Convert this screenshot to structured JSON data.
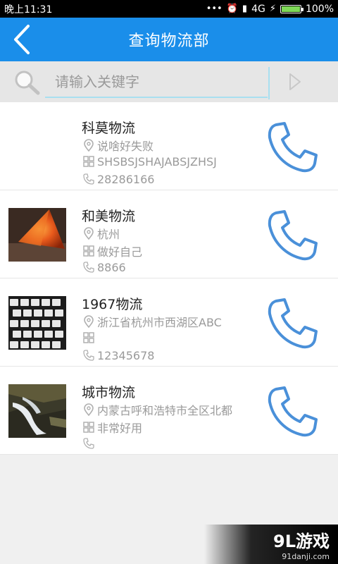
{
  "status_bar": {
    "time": "晚上11:31",
    "network": "4G",
    "battery": "100%"
  },
  "app_bar": {
    "title": "查询物流部"
  },
  "search": {
    "placeholder": "请输入关键字",
    "value": ""
  },
  "companies": [
    {
      "name": "科莫物流",
      "address": "说啥好失败",
      "note": "SHSBSJSHAJABSJZHSJ",
      "phone": "28286166"
    },
    {
      "name": "和美物流",
      "address": "杭州",
      "note": "做好自己",
      "phone": "8866"
    },
    {
      "name": "1967物流",
      "address": "浙江省杭州市西湖区ABC",
      "note": "",
      "phone": "12345678"
    },
    {
      "name": "城市物流",
      "address": "内蒙古呼和浩特市全区北都",
      "note": "非常好用",
      "phone": ""
    }
  ],
  "watermark": {
    "main": "9L游戏",
    "sub": "91danji.com"
  },
  "colors": {
    "accent": "#1a8eea",
    "phone_icon": "#4a90d9"
  }
}
